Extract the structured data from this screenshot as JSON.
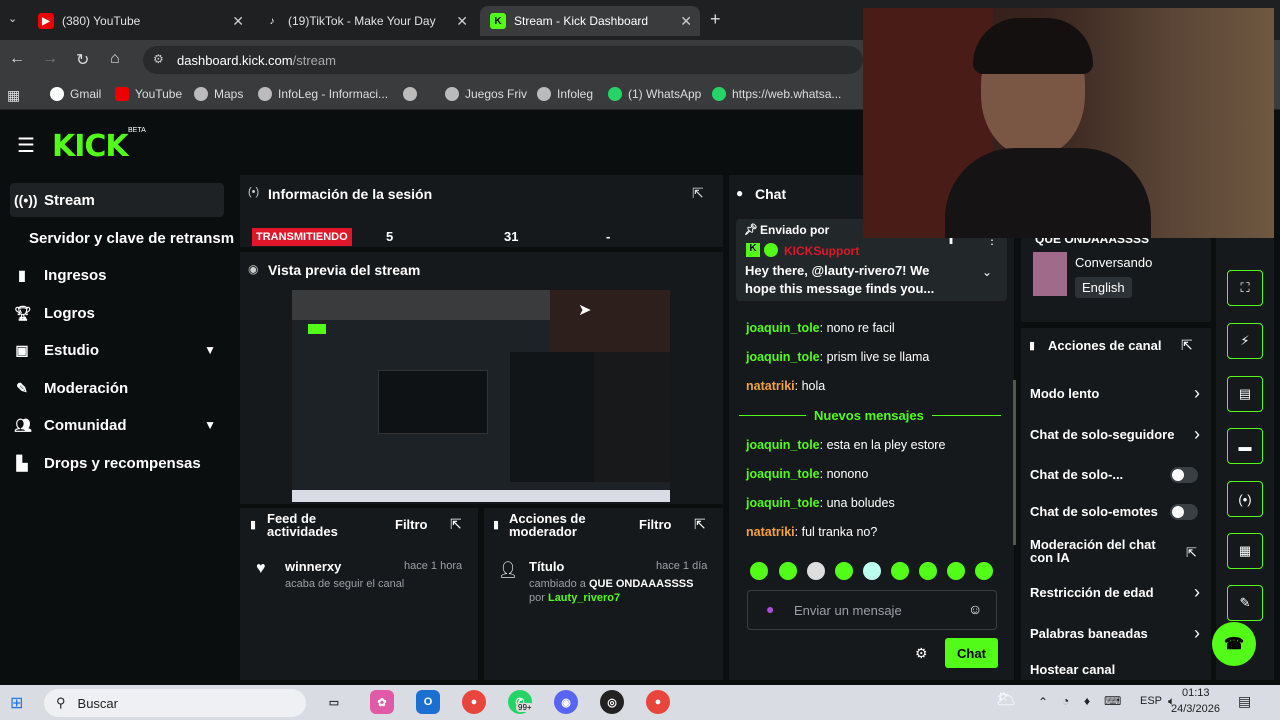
{
  "browser": {
    "tabs": [
      {
        "label": "(380) YouTube"
      },
      {
        "label": "(19)TikTok - Make Your Day"
      },
      {
        "label": "Stream - Kick Dashboard"
      }
    ],
    "url_domain": "dashboard.kick.com",
    "url_path": "/stream",
    "bookmarks": [
      "Gmail",
      "YouTube",
      "Maps",
      "InfoLeg - Informaci...",
      "Juegos Friv",
      "Infoleg",
      "(1) WhatsApp",
      "https://web.whatsa..."
    ]
  },
  "brand": {
    "logo": "KICK",
    "badge": "BETA",
    "accent": "#53fc18"
  },
  "sidebar": {
    "items": [
      {
        "label": "Stream",
        "icon": "broadcast-icon"
      },
      {
        "label": "Servidor y clave de retransm"
      },
      {
        "label": "Ingresos",
        "icon": "chart-icon"
      },
      {
        "label": "Logros",
        "icon": "trophy-icon"
      },
      {
        "label": "Estudio",
        "icon": "video-icon"
      },
      {
        "label": "Moderación",
        "icon": "wrench-icon"
      },
      {
        "label": "Comunidad",
        "icon": "community-icon"
      },
      {
        "label": "Drops y recompensas",
        "icon": "drops-icon"
      }
    ]
  },
  "session": {
    "title": "Información de la sesión",
    "status": "TRANSMITIENDO",
    "stat1": "5",
    "stat2": "31",
    "stat3": "-"
  },
  "preview": {
    "title": "Vista previa del stream"
  },
  "feed": {
    "title": "Feed de actividades",
    "filter": "Filtro",
    "user": "winnerxy",
    "time": "hace 1 hora",
    "desc": "acaba de seguir el canal"
  },
  "modactions": {
    "title": "Acciones de moderador",
    "filter": "Filtro",
    "item": "Título",
    "time": "hace 1 día",
    "desc_prefix": "cambiado a",
    "new_title": "QUE ONDAAASSSS",
    "by_prefix": "por",
    "by_user": "Lauty_rivero7"
  },
  "chat": {
    "title": "Chat",
    "pinned": {
      "label": "Enviado por",
      "sender": "KICKSupport",
      "text": "Hey there, @lauty-rivero7! We hope this message finds you..."
    },
    "messages_before": [
      {
        "user": "joaquin_tole",
        "text": "nono re facil"
      },
      {
        "user": "joaquin_tole",
        "text": "prism live se llama"
      },
      {
        "user": "natatriki",
        "text": "hola"
      }
    ],
    "new_label": "Nuevos mensajes",
    "messages_after": [
      {
        "user": "joaquin_tole",
        "text": "esta en la pley estore"
      },
      {
        "user": "joaquin_tole",
        "text": "nonono"
      },
      {
        "user": "joaquin_tole",
        "text": "una boludes"
      },
      {
        "user": "natatriki",
        "text": "ful tranka no?"
      }
    ],
    "input_placeholder": "Enviar un mensaje",
    "send_label": "Chat"
  },
  "channel": {
    "stream_title": "QUE ONDAAASSSS",
    "category": "Conversando",
    "language": "English"
  },
  "actions": {
    "title": "Acciones de canal",
    "items": [
      {
        "label": "Modo lento",
        "kind": "arrow"
      },
      {
        "label": "Chat de solo-seguidore",
        "kind": "arrow"
      },
      {
        "label": "Chat de solo-...",
        "kind": "toggle",
        "value": "off"
      },
      {
        "label": "Chat de solo-emotes",
        "kind": "toggle",
        "value": "off"
      },
      {
        "label": "Moderación del chat con IA",
        "kind": "external"
      },
      {
        "label": "Restricción de edad",
        "kind": "arrow"
      },
      {
        "label": "Palabras baneadas",
        "kind": "arrow"
      },
      {
        "label": "Hostear canal",
        "kind": "none"
      }
    ]
  },
  "taskbar": {
    "search": "Buscar",
    "lang": "ESP",
    "time": "01:13",
    "date": "24/3/2026",
    "badge": "99+"
  }
}
